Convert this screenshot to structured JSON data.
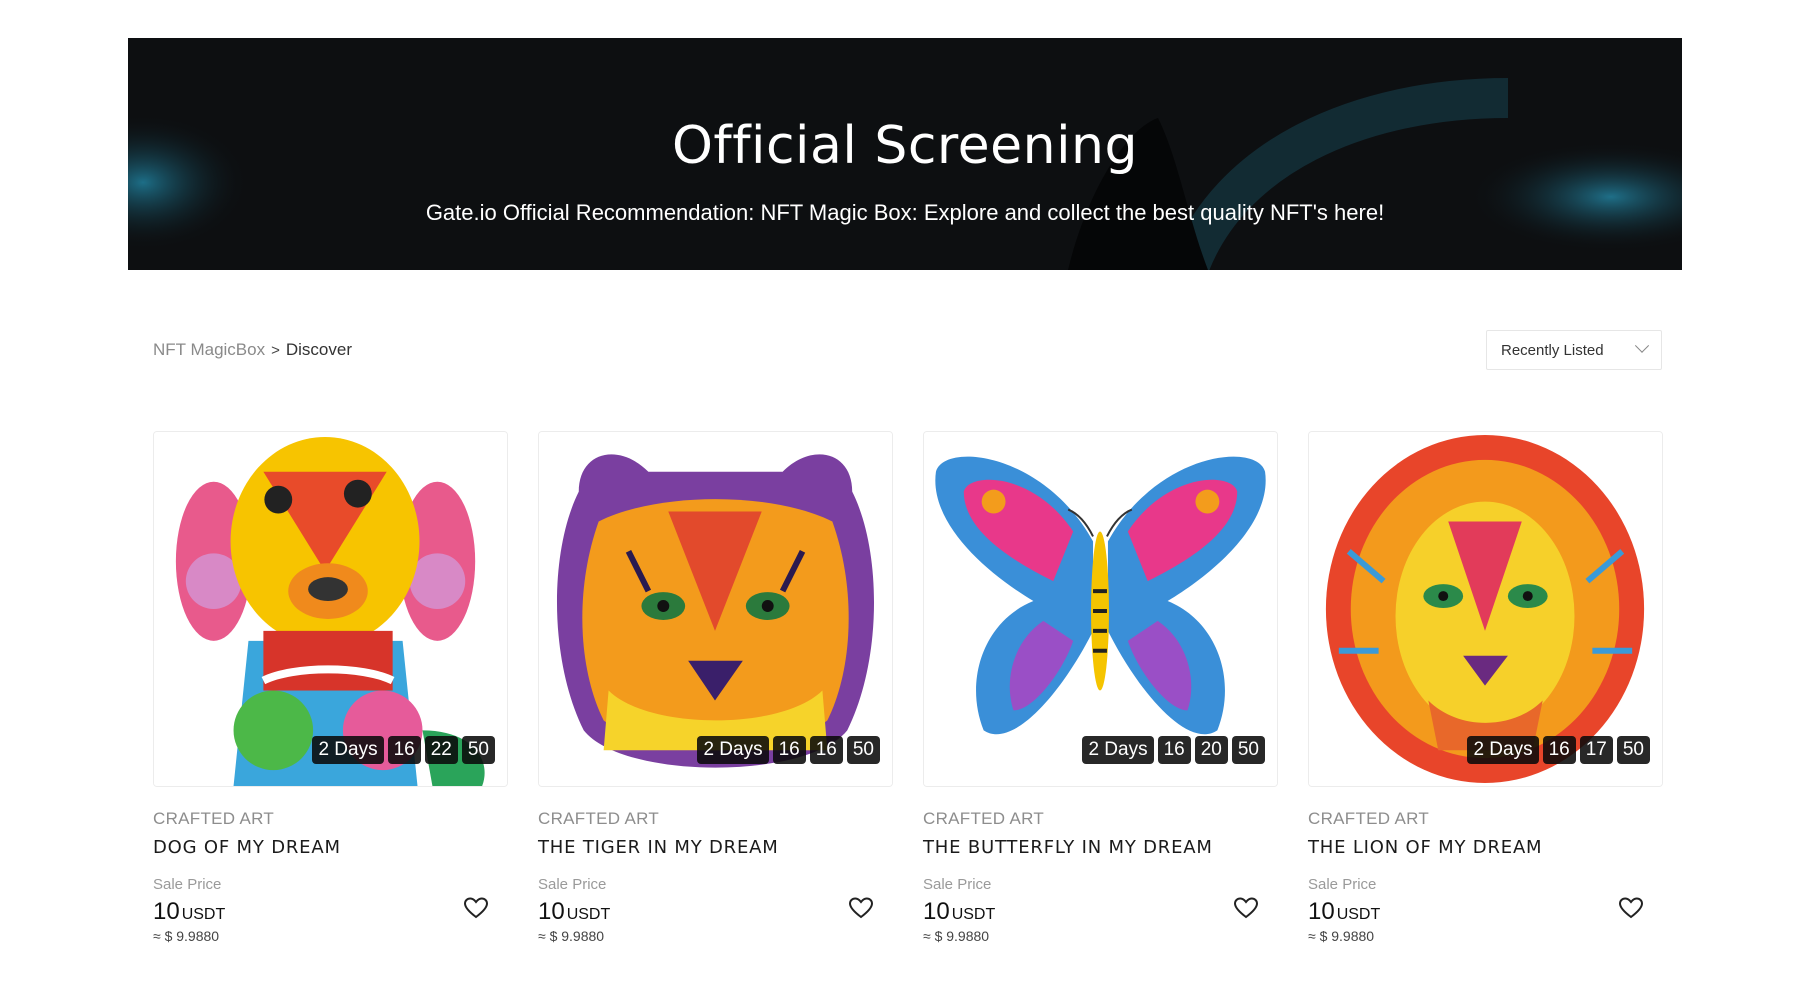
{
  "banner": {
    "title": "Official Screening",
    "subtitle": "Gate.io Official Recommendation: NFT Magic Box: Explore and collect the best quality NFT's here!"
  },
  "breadcrumb": {
    "root": "NFT MagicBox",
    "separator": ">",
    "current": "Discover"
  },
  "sort": {
    "selected": "Recently Listed"
  },
  "colors": {
    "banner_bg": "#0d0f11",
    "banner_accent": "#1b5d73"
  },
  "cards": [
    {
      "category": "CRAFTED ART",
      "name": "DOG OF MY DREAM",
      "sale_label": "Sale Price",
      "price": "10",
      "unit": "USDT",
      "usd": "≈ $ 9.9880",
      "timer": {
        "days": "2 Days",
        "h": "16",
        "m": "22",
        "s": "50"
      },
      "image": "colorful-dog-art"
    },
    {
      "category": "CRAFTED ART",
      "name": "THE TIGER IN MY DREAM",
      "sale_label": "Sale Price",
      "price": "10",
      "unit": "USDT",
      "usd": "≈ $ 9.9880",
      "timer": {
        "days": "2 Days",
        "h": "16",
        "m": "16",
        "s": "50"
      },
      "image": "colorful-tiger-art"
    },
    {
      "category": "CRAFTED ART",
      "name": "THE BUTTERFLY IN MY DREAM",
      "sale_label": "Sale Price",
      "price": "10",
      "unit": "USDT",
      "usd": "≈ $ 9.9880",
      "timer": {
        "days": "2 Days",
        "h": "16",
        "m": "20",
        "s": "50"
      },
      "image": "colorful-butterfly-art"
    },
    {
      "category": "CRAFTED ART",
      "name": "THE LION OF MY DREAM",
      "sale_label": "Sale Price",
      "price": "10",
      "unit": "USDT",
      "usd": "≈ $ 9.9880",
      "timer": {
        "days": "2 Days",
        "h": "16",
        "m": "17",
        "s": "50"
      },
      "image": "colorful-lion-art"
    }
  ]
}
